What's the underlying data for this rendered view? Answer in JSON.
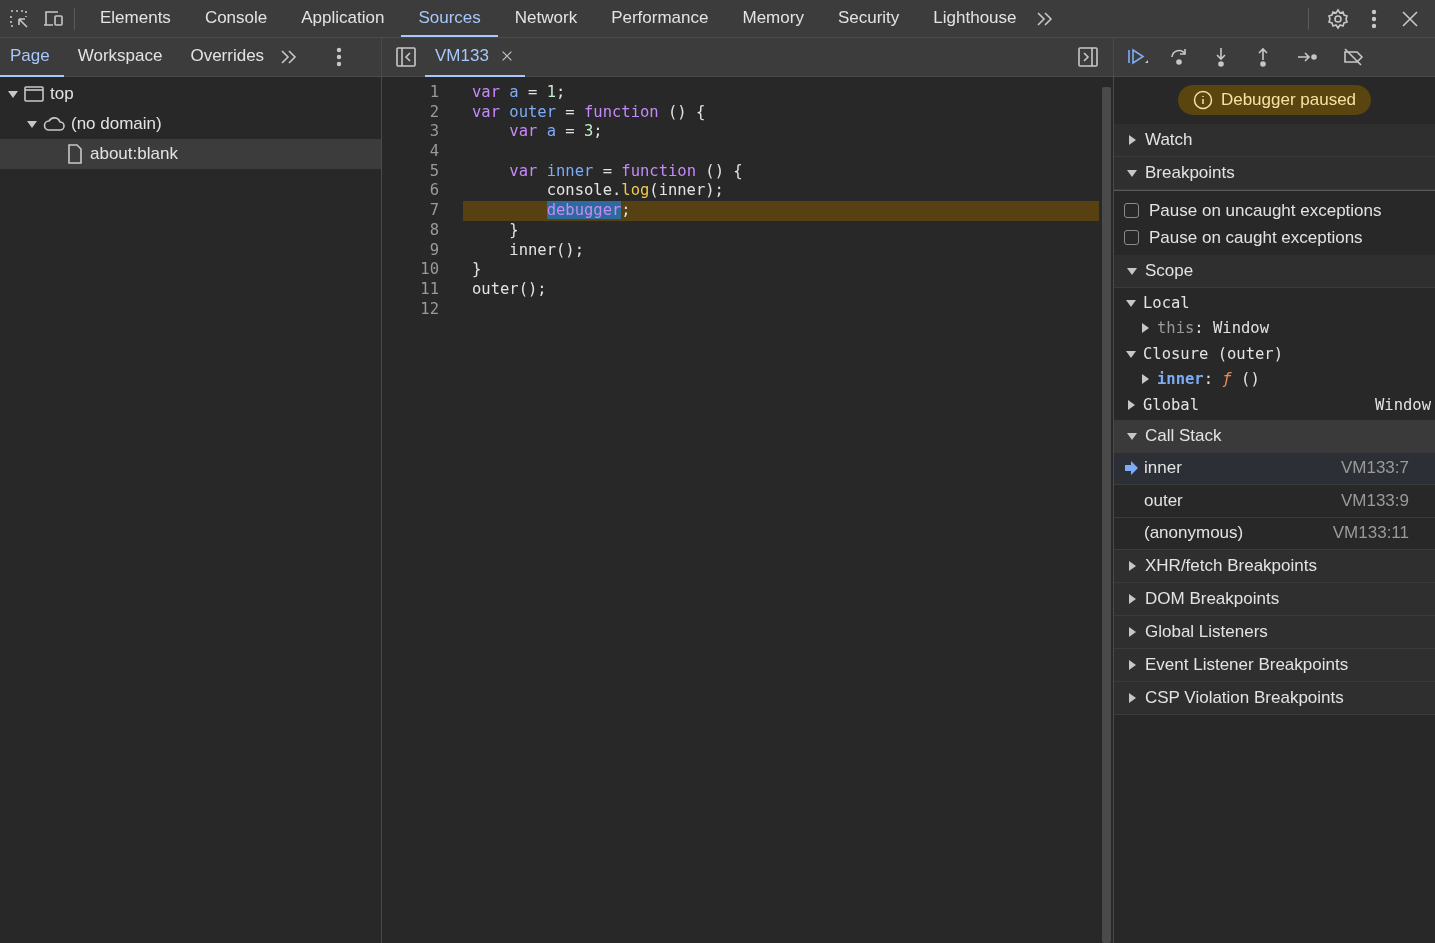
{
  "main_tabs": [
    {
      "label": "Elements",
      "selected": false
    },
    {
      "label": "Console",
      "selected": false
    },
    {
      "label": "Application",
      "selected": false
    },
    {
      "label": "Sources",
      "selected": true
    },
    {
      "label": "Network",
      "selected": false
    },
    {
      "label": "Performance",
      "selected": false
    },
    {
      "label": "Memory",
      "selected": false
    },
    {
      "label": "Security",
      "selected": false
    },
    {
      "label": "Lighthouse",
      "selected": false
    }
  ],
  "navigator": {
    "tabs": [
      {
        "label": "Page",
        "selected": true
      },
      {
        "label": "Workspace",
        "selected": false
      },
      {
        "label": "Overrides",
        "selected": false
      }
    ],
    "tree": [
      {
        "label": "top",
        "kind": "frame",
        "expanded": true,
        "selected": false,
        "children": [
          {
            "label": "(no domain)",
            "kind": "domain",
            "expanded": true,
            "selected": false,
            "children": [
              {
                "label": "about:blank",
                "kind": "file",
                "selected": true
              }
            ]
          }
        ]
      }
    ]
  },
  "editor": {
    "tabs": [
      {
        "label": "VM133",
        "selected": true
      }
    ],
    "lines": [
      {
        "number": "1",
        "paused": false,
        "tokens": [
          {
            "t": "var",
            "kind": "keyword"
          },
          {
            "t": " a",
            "kind": "definition"
          },
          {
            "t": " = ",
            "kind": "plain"
          },
          {
            "t": "1",
            "kind": "number"
          },
          {
            "t": ";",
            "kind": "plain"
          }
        ]
      },
      {
        "number": "2",
        "paused": false,
        "tokens": [
          {
            "t": "var",
            "kind": "keyword"
          },
          {
            "t": " outer",
            "kind": "definition"
          },
          {
            "t": " = ",
            "kind": "plain"
          },
          {
            "t": "function",
            "kind": "keyword"
          },
          {
            "t": " () {",
            "kind": "plain"
          }
        ],
        "children": [
          {
            "number": "3",
            "paused": false,
            "tokens": [
              {
                "t": "var",
                "kind": "keyword"
              },
              {
                "t": " a",
                "kind": "definition"
              },
              {
                "t": " = ",
                "kind": "plain"
              },
              {
                "t": "3",
                "kind": "number"
              },
              {
                "t": ";",
                "kind": "plain"
              }
            ]
          },
          {
            "number": "4",
            "paused": false
          },
          {
            "number": "5",
            "paused": false,
            "tokens": [
              {
                "t": "var",
                "kind": "keyword"
              },
              {
                "t": " inner",
                "kind": "definition"
              },
              {
                "t": " = ",
                "kind": "plain"
              },
              {
                "t": "function",
                "kind": "keyword"
              },
              {
                "t": " () {",
                "kind": "plain"
              }
            ],
            "children": [
              {
                "number": "6",
                "paused": false,
                "tokens": [
                  {
                    "t": "console.",
                    "kind": "plain"
                  },
                  {
                    "t": "log",
                    "kind": "property"
                  },
                  {
                    "t": "(inner);",
                    "kind": "plain"
                  }
                ]
              },
              {
                "number": "7",
                "paused": true,
                "tokens": [
                  {
                    "t": "debugger",
                    "kind": "keyword",
                    "selected": true
                  },
                  {
                    "t": ";",
                    "kind": "plain"
                  }
                ]
              }
            ]
          },
          {
            "number": "8",
            "paused": false,
            "tokens": [
              {
                "t": "}",
                "kind": "plain"
              }
            ]
          },
          {
            "number": "9",
            "paused": false,
            "tokens": [
              {
                "t": "inner();",
                "kind": "plain"
              }
            ]
          }
        ]
      },
      {
        "number": "10",
        "paused": false,
        "tokens": [
          {
            "t": "}",
            "kind": "plain"
          }
        ]
      },
      {
        "number": "11",
        "paused": false,
        "tokens": [
          {
            "t": "outer();",
            "kind": "plain"
          }
        ]
      },
      {
        "number": "12",
        "paused": false
      }
    ]
  },
  "debugger": {
    "status": "Debugger paused",
    "sections": [
      {
        "kind": "plain",
        "title": "Watch",
        "expanded": false
      },
      {
        "kind": "breakpoints",
        "title": "Breakpoints",
        "expanded": true,
        "options": [
          {
            "label": "Pause on uncaught exceptions",
            "checked": false
          },
          {
            "label": "Pause on caught exceptions",
            "checked": false
          }
        ]
      },
      {
        "kind": "scope",
        "title": "Scope",
        "expanded": true,
        "scopes": [
          {
            "name": "Local",
            "expanded": true,
            "children": [
              {
                "key": "this",
                "kind": "internal",
                "sep": ":",
                "value": "Window",
                "expanded": false
              }
            ]
          },
          {
            "name": "Closure (outer)",
            "expanded": true,
            "children": [
              {
                "key": "inner",
                "kind": "own",
                "sep": ":",
                "mark": "ƒ",
                "value": "()",
                "expanded": false
              }
            ]
          },
          {
            "name": "Global",
            "expanded": false,
            "value": "Window"
          }
        ]
      },
      {
        "kind": "callstack",
        "title": "Call Stack",
        "expanded": true,
        "frames": [
          {
            "name": "inner",
            "location": "VM133:7",
            "selected": true
          },
          {
            "name": "outer",
            "location": "VM133:9",
            "selected": false
          },
          {
            "name": "(anonymous)",
            "location": "VM133:11",
            "selected": false
          }
        ]
      },
      {
        "kind": "plain",
        "title": "XHR/fetch Breakpoints",
        "expanded": false
      },
      {
        "kind": "plain",
        "title": "DOM Breakpoints",
        "expanded": false
      },
      {
        "kind": "plain",
        "title": "Global Listeners",
        "expanded": false
      },
      {
        "kind": "plain",
        "title": "Event Listener Breakpoints",
        "expanded": false
      },
      {
        "kind": "plain",
        "title": "CSP Violation Breakpoints",
        "expanded": false
      }
    ]
  }
}
